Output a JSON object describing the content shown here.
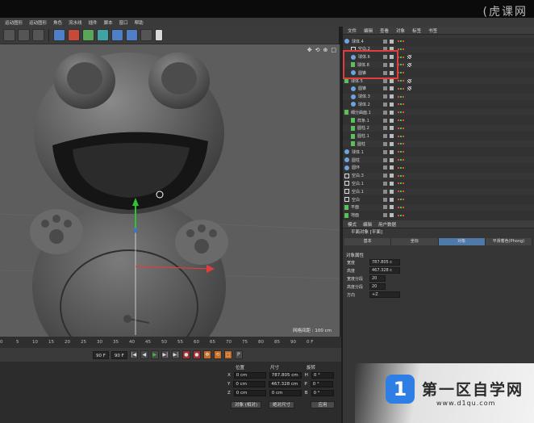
{
  "watermark_top": "(虎课网",
  "menu": [
    "运动图形",
    "运动图形",
    "角色",
    "流水线",
    "插件",
    "脚本",
    "窗口",
    "帮助"
  ],
  "viewport": {
    "label": "网格间距 : 100 cm"
  },
  "timeline": {
    "ticks": [
      "0",
      "5",
      "10",
      "15",
      "20",
      "25",
      "30",
      "35",
      "40",
      "45",
      "50",
      "55",
      "60",
      "65",
      "70",
      "75",
      "80",
      "85",
      "90"
    ],
    "end_label": "0 F"
  },
  "playback": {
    "frame_a": "90 F",
    "frame_b": "90 F"
  },
  "coords": {
    "head_pos": "位置",
    "head_size": "尺寸",
    "head_rot": "旋转",
    "rows": [
      {
        "axis": "X",
        "pos": "0 cm",
        "size": "787.805 cm",
        "rot_axis": "H",
        "rot": "0 °"
      },
      {
        "axis": "Y",
        "pos": "0 cm",
        "size": "467.328 cm",
        "rot_axis": "P",
        "rot": "0 °"
      },
      {
        "axis": "Z",
        "pos": "0 cm",
        "size": "0 cm",
        "rot_axis": "B",
        "rot": "0 °"
      }
    ],
    "btn_obj": "对象 (相对)",
    "btn_abs": "绝对尺寸",
    "btn_apply": "应用"
  },
  "objects_tabs": [
    "文件",
    "编辑",
    "查看",
    "对象",
    "标签",
    "书签"
  ],
  "objects": [
    {
      "name": "球体.4",
      "type": "sphere"
    },
    {
      "name": "空白.2",
      "type": "null"
    },
    {
      "name": "球体.6",
      "type": "sphere"
    },
    {
      "name": "球体.8",
      "type": "sym"
    },
    {
      "name": "圆锥",
      "type": "sphere"
    },
    {
      "name": "球体.5",
      "type": "sym"
    },
    {
      "name": "圆锥",
      "type": "sphere"
    },
    {
      "name": "球体.3",
      "type": "sphere"
    },
    {
      "name": "球体.2",
      "type": "sphere"
    },
    {
      "name": "细分曲面.1",
      "type": "sym"
    },
    {
      "name": "样条.1",
      "type": "sym"
    },
    {
      "name": "圆柱.2",
      "type": "sym"
    },
    {
      "name": "圆柱.1",
      "type": "sym"
    },
    {
      "name": "圆柱",
      "type": "sym"
    },
    {
      "name": "球体.1",
      "type": "sphere"
    },
    {
      "name": "圆柱",
      "type": "sphere"
    },
    {
      "name": "圆环",
      "type": "sphere"
    },
    {
      "name": "空白.3",
      "type": "null"
    },
    {
      "name": "空白.1",
      "type": "null"
    },
    {
      "name": "空白.1",
      "type": "null"
    },
    {
      "name": "空白",
      "type": "null"
    },
    {
      "name": "平面",
      "type": "sym"
    },
    {
      "name": "地面",
      "type": "sym"
    }
  ],
  "attributes": {
    "tabs": [
      "模式",
      "编辑",
      "用户数据"
    ],
    "title": "平面对象 [平面]",
    "subtabs": [
      "基本",
      "坐标",
      "对象",
      "平滑着色(Phong)"
    ],
    "section": "对象属性",
    "rows": [
      {
        "label": "宽度",
        "value": "787.805 c"
      },
      {
        "label": "高度",
        "value": "467.328 c"
      },
      {
        "label": "宽度分段",
        "value": "20"
      },
      {
        "label": "高度分段",
        "value": "20"
      },
      {
        "label": "方向",
        "value": "+Z"
      }
    ]
  },
  "logo": {
    "badge": "1",
    "text": "第一区自学网",
    "url": "www.d1qu.com"
  }
}
